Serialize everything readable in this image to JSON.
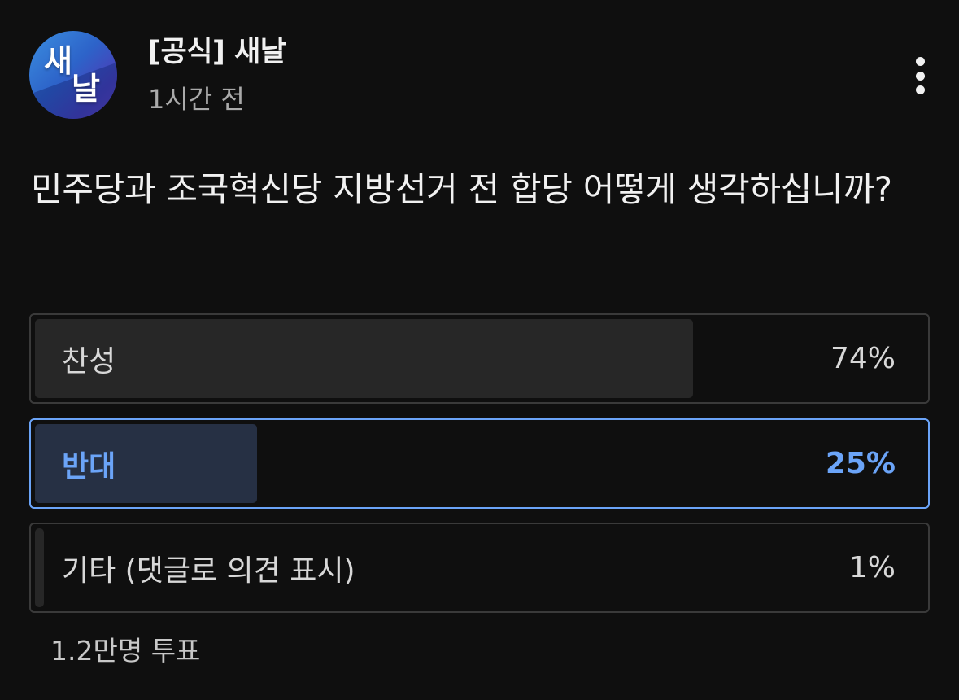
{
  "channel": {
    "avatar_text": [
      "새",
      "날"
    ],
    "name": "[공식] 새날",
    "time": "1시간 전"
  },
  "poll": {
    "question": "민주당과 조국혁신당 지방선거 전 합당 어떻게 생각하십니까?",
    "options": [
      {
        "label": "찬성",
        "percent_label": "74%",
        "share": 0.74,
        "selected": false
      },
      {
        "label": "반대",
        "percent_label": "25%",
        "share": 0.25,
        "selected": true
      },
      {
        "label": "기타 (댓글로 의견 표시)",
        "percent_label": "1%",
        "share": 0.01,
        "selected": false
      }
    ],
    "vote_count": "1.2만명 투표"
  },
  "icons": {
    "menu": "more-vertical-icon"
  },
  "colors": {
    "background": "#0f0f0f",
    "accent": "#6ba4f8",
    "option_fill": "#272727",
    "selected_fill": "#263044"
  }
}
